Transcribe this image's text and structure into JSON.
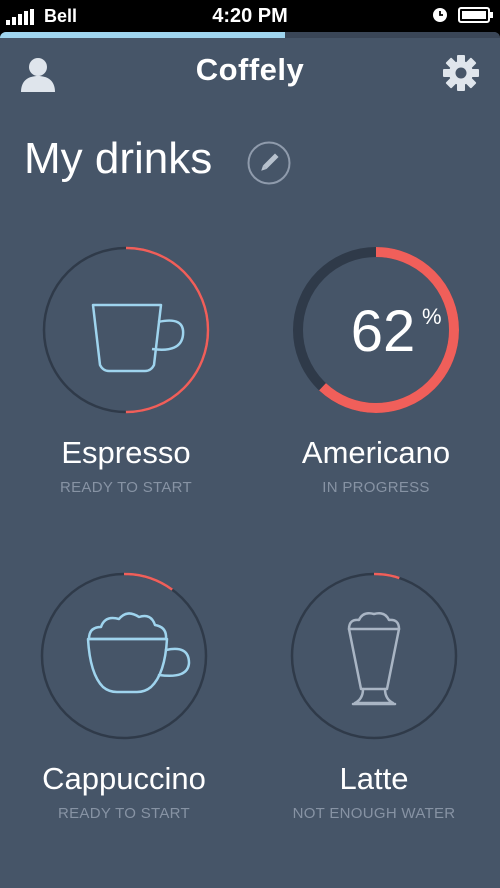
{
  "status_bar": {
    "carrier": "Bell",
    "time": "4:20 PM",
    "icons": [
      "signal-icon",
      "clock-icon",
      "battery-icon"
    ]
  },
  "top_progress": {
    "fraction": 0.57,
    "color": "#9fd4ee"
  },
  "nav": {
    "title": "Coffely",
    "left_icon": "profile-icon",
    "right_icon": "gear-icon"
  },
  "heading": {
    "title": "My drinks",
    "action_icon": "pencil-icon"
  },
  "colors": {
    "background": "#465568",
    "ring_track": "#2f3a49",
    "accent": "#f05f5a",
    "cup_blue": "#9fd4ee",
    "muted_text": "#8793a4",
    "latte_icon": "#a9b5c4"
  },
  "drinks": [
    {
      "name": "Espresso",
      "status": "READY TO START",
      "icon": "espresso-cup-icon",
      "progress": 0.5
    },
    {
      "name": "Americano",
      "status": "IN PROGRESS",
      "icon": "progress-ring",
      "progress": 0.62,
      "percent_value": "62",
      "percent_sign": "%"
    },
    {
      "name": "Cappuccino",
      "status": "READY TO START",
      "icon": "cappuccino-cup-icon",
      "progress": 0.1
    },
    {
      "name": "Latte",
      "status": "NOT ENOUGH WATER",
      "icon": "latte-glass-icon",
      "progress": 0.05
    }
  ]
}
